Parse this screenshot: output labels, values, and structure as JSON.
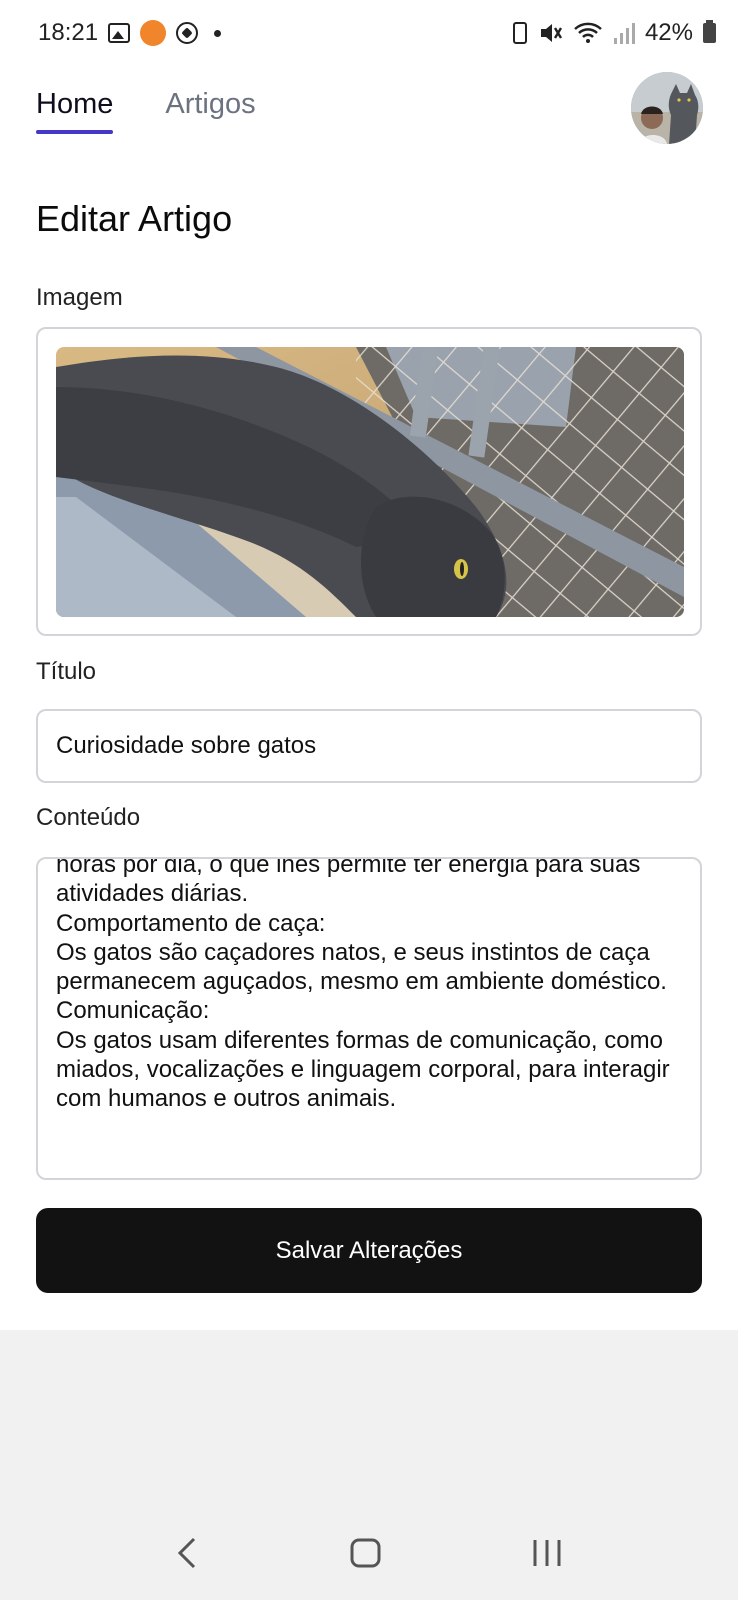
{
  "status_bar": {
    "time": "18:21",
    "battery": "42%"
  },
  "nav": {
    "tabs": [
      {
        "label": "Home",
        "active": true
      },
      {
        "label": "Artigos",
        "active": false
      }
    ]
  },
  "page_title": "Editar Artigo",
  "form": {
    "image_label": "Imagem",
    "title_label": "Título",
    "title_value": "Curiosidade sobre gatos",
    "content_label": "Conteúdo",
    "content_value": "horas por dia, o que lhes permite ter energia para suas atividades diárias.\nComportamento de caça:\nOs gatos são caçadores natos, e seus instintos de caça permanecem aguçados, mesmo em ambiente doméstico.\nComunicação:\nOs gatos usam diferentes formas de comunicação, como miados, vocalizações e linguagem corporal, para interagir com humanos e outros animais."
  },
  "save_button": "Salvar Alterações",
  "icons": {
    "status": [
      "gallery-icon",
      "burger-king-icon",
      "soccer-ball-icon",
      "notification-dot-icon",
      "battery-saver-icon",
      "mute-icon",
      "wifi-icon",
      "signal-icon",
      "battery-icon"
    ],
    "nav": [
      "back-icon",
      "home-icon",
      "recents-icon"
    ]
  },
  "colors": {
    "accent": "#4338ca",
    "button": "#121212",
    "border": "#d4d4d8"
  }
}
